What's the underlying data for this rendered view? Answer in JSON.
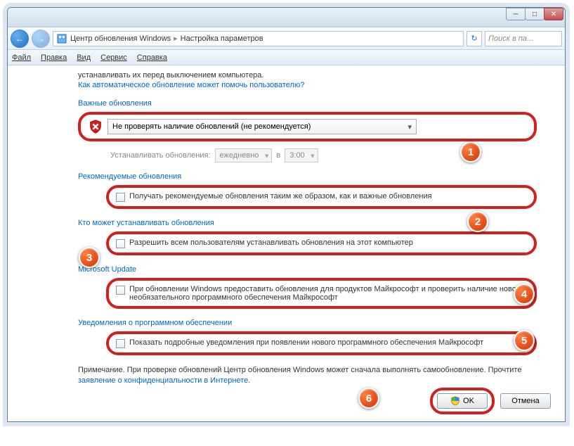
{
  "window": {
    "minimize": "─",
    "maximize": "□",
    "close": "✕"
  },
  "nav": {
    "back": "←",
    "forward": "→",
    "crumb1": "Центр обновления Windows",
    "crumb2": "Настройка параметров",
    "refresh": "↻",
    "search_placeholder": "Поиск в па..."
  },
  "menu": {
    "file": "Файл",
    "edit": "Правка",
    "view": "Вид",
    "tools": "Сервис",
    "help": "Справка"
  },
  "content": {
    "intro": "устанавливать их перед выключением компьютера.",
    "help_link": "Как автоматическое обновление может помочь пользователю?",
    "section_important": "Важные обновления",
    "dropdown_value": "Не проверять наличие обновлений (не рекомендуется)",
    "schedule_label": "Устанавливать обновления:",
    "schedule_freq": "ежедневно",
    "schedule_at": "в",
    "schedule_time": "3:00",
    "section_recommended": "Рекомендуемые обновления",
    "cb_recommended": "Получать рекомендуемые обновления таким же образом, как и важные обновления",
    "section_who": "Кто может устанавливать обновления",
    "cb_allusers": "Разрешить всем пользователям устанавливать обновления на этот компьютер",
    "section_msupdate": "Microsoft Update",
    "cb_msupdate": "При обновлении Windows предоставить обновления для продуктов Майкрософт и проверить наличие нового необязательного программного обеспечения Майкрософт",
    "section_notify": "Уведомления о программном обеспечении",
    "cb_notify": "Показать подробные уведомления при появлении нового программного обеспечения Майкрософт",
    "note_prefix": "Примечание. При проверке обновлений Центр обновления Windows может сначала выполнять самообновление. Прочтите ",
    "note_link": "заявление о конфиденциальности в Интернете",
    "note_suffix": "."
  },
  "buttons": {
    "ok": "OK",
    "cancel": "Отмена"
  },
  "callouts": {
    "c1": "1",
    "c2": "2",
    "c3": "3",
    "c4": "4",
    "c5": "5",
    "c6": "6"
  }
}
